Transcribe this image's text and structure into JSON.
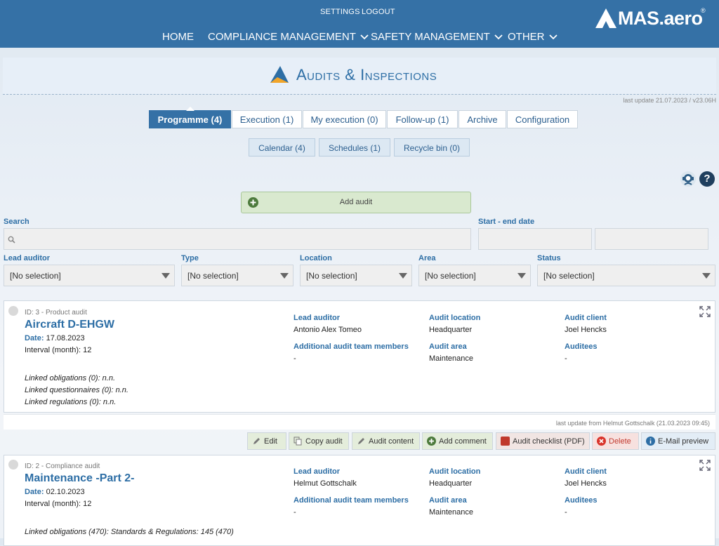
{
  "header": {
    "settings": "SETTINGS",
    "logout": "LOGOUT",
    "nav": [
      "HOME",
      "COMPLIANCE MANAGEMENT",
      "SAFETY MANAGEMENT",
      "OTHER"
    ],
    "logo_text": "MAS.aero",
    "logo_mark": "®"
  },
  "page": {
    "title": "Audits & Inspections",
    "last_update": "last update 21.07.2023 / v23.06H"
  },
  "tabs": [
    "Programme (4)",
    "Execution (1)",
    "My execution (0)",
    "Follow-up (1)",
    "Archive",
    "Configuration"
  ],
  "subtabs": [
    "Calendar (4)",
    "Schedules (1)",
    "Recycle bin (0)"
  ],
  "add_button": "Add audit",
  "filters": {
    "search_label": "Search",
    "date_label": "Start - end date",
    "lead_auditor_label": "Lead auditor",
    "type_label": "Type",
    "location_label": "Location",
    "area_label": "Area",
    "status_label": "Status",
    "no_selection": "[No selection]"
  },
  "labels": {
    "date": "Date:",
    "lead_auditor": "Lead auditor",
    "additional": "Additional audit team members",
    "location": "Audit location",
    "area": "Audit area",
    "client": "Audit client",
    "auditees": "Auditees"
  },
  "audits": [
    {
      "meta": "ID: 3 - Product audit",
      "title": "Aircraft D-EHGW",
      "date": "17.08.2023",
      "interval": "Interval (month): 12",
      "lead_auditor": "Antonio Alex Tomeo",
      "additional": "-",
      "location": "Headquarter",
      "area": "Maintenance",
      "client": "Joel Hencks",
      "auditees": "-",
      "linked_obligations": "Linked obligations (0): n.n.",
      "linked_questionnaires": "Linked questionnaires (0): n.n.",
      "linked_regulations": "Linked regulations (0): n.n.",
      "footer": "last update from Helmut Gottschalk (21.03.2023 09:45)"
    },
    {
      "meta": "ID: 2 - Compliance audit",
      "title": "Maintenance -Part 2-",
      "date": "02.10.2023",
      "interval": "Interval (month): 12",
      "lead_auditor": "Helmut Gottschalk",
      "additional": "-",
      "location": "Headquarter",
      "area": "Maintenance",
      "client": "Joel Hencks",
      "auditees": "-",
      "linked_obligations": "Linked obligations (470): Standards & Regulations: 145 (470)"
    }
  ],
  "actions": [
    "Edit",
    "Copy audit",
    "Audit content",
    "Add comment",
    "Audit checklist (PDF)",
    "Delete",
    "E-Mail preview"
  ]
}
